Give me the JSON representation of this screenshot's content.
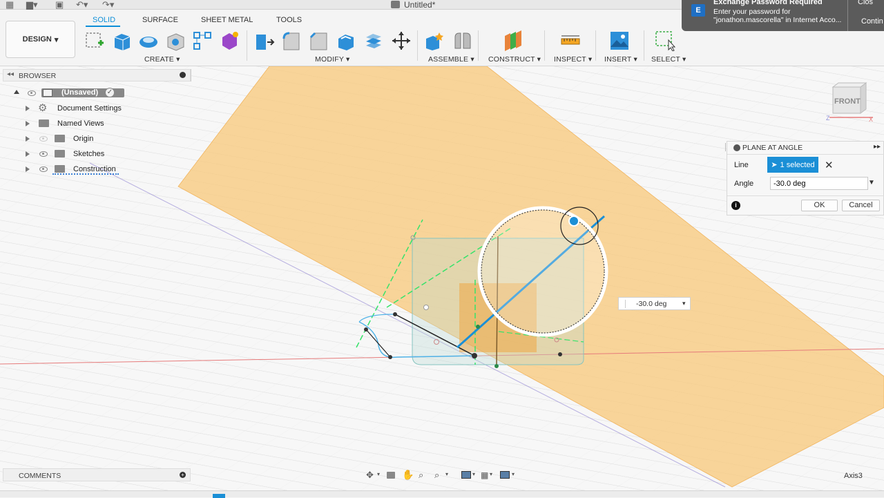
{
  "app": {
    "document_title": "Untitled*"
  },
  "toolbar": {
    "workspace_label": "DESIGN",
    "tabs": [
      "SOLID",
      "SURFACE",
      "SHEET METAL",
      "TOOLS"
    ],
    "active_tab": "SOLID",
    "groups": {
      "create": "CREATE",
      "modify": "MODIFY",
      "assemble": "ASSEMBLE",
      "construct": "CONSTRUCT",
      "inspect": "INSPECT",
      "insert": "INSERT",
      "select": "SELECT"
    },
    "accent_color": "#0d8ed8"
  },
  "notification": {
    "title": "Exchange Password Required",
    "line1": "Enter your password for",
    "line2": "\"jonathon.mascorella\" in Internet Acco...",
    "action1": "Clos",
    "action2": "Contin"
  },
  "browser": {
    "header": "BROWSER",
    "root_label": "(Unsaved)",
    "items": [
      {
        "label": "Document Settings",
        "icon": "gear-icon"
      },
      {
        "label": "Named Views",
        "icon": "folder-icon"
      },
      {
        "label": "Origin",
        "icon": "folder-icon"
      },
      {
        "label": "Sketches",
        "icon": "folder-icon"
      },
      {
        "label": "Construction",
        "icon": "folder-icon"
      }
    ]
  },
  "dialog": {
    "title": "PLANE AT ANGLE",
    "line_label": "Line",
    "selection": "1 selected",
    "angle_label": "Angle",
    "angle_value": "-30.0 deg",
    "ok": "OK",
    "cancel": "Cancel"
  },
  "floating_input": {
    "value": "-30.0 deg"
  },
  "viewcube": {
    "face": "FRONT"
  },
  "comments": {
    "label": "COMMENTS"
  },
  "status": {
    "axis": "Axis3"
  },
  "colors": {
    "plane": "#f8c87a",
    "selection_blue": "#1b8fd6",
    "sketch_green": "#36e36a"
  }
}
